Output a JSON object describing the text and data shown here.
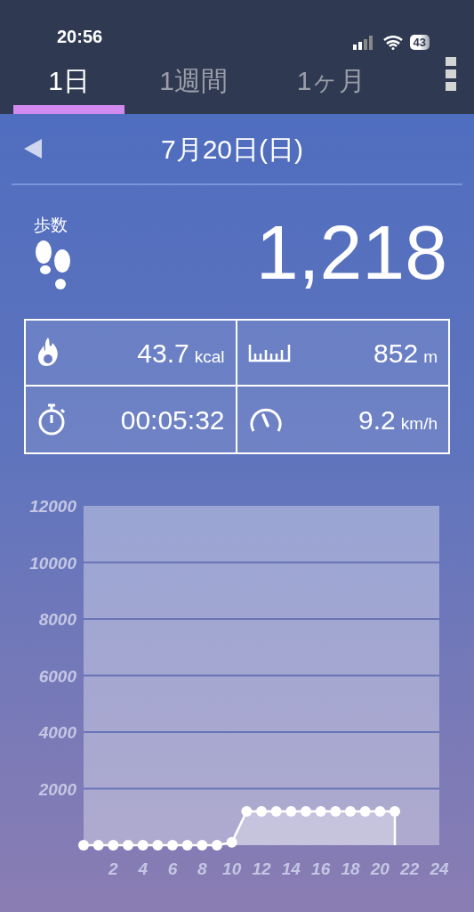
{
  "status_bar": {
    "time": "20:56",
    "battery": "43"
  },
  "tabs": [
    {
      "label": "1日",
      "selected": true
    },
    {
      "label": "1週間",
      "selected": false
    },
    {
      "label": "1ヶ月",
      "selected": false
    }
  ],
  "date": "7月20日(日)",
  "steps": {
    "label": "歩数",
    "value": "1,218"
  },
  "stats": [
    {
      "kind": "calories",
      "value": "43.7",
      "unit": "kcal"
    },
    {
      "kind": "distance",
      "value": "852",
      "unit": "m"
    },
    {
      "kind": "time",
      "value": "00:05:32"
    },
    {
      "kind": "speed",
      "value": "9.2",
      "unit": "km/h"
    }
  ],
  "chart_data": {
    "type": "area",
    "x": [
      0,
      1,
      2,
      3,
      4,
      5,
      6,
      7,
      8,
      9,
      10,
      11,
      12,
      13,
      14,
      15,
      16,
      17,
      18,
      19,
      20,
      21
    ],
    "grid": true,
    "series": [
      {
        "color": "#ffffff",
        "values": [
          0,
          0,
          0,
          0,
          0,
          0,
          0,
          0,
          0,
          0,
          100,
          1200,
          1200,
          1200,
          1200,
          1200,
          1200,
          1200,
          1200,
          1200,
          1200,
          1200
        ]
      }
    ],
    "xlim": [
      0,
      24
    ],
    "ylim": [
      0,
      12000
    ],
    "xticks": [
      2,
      4,
      6,
      8,
      10,
      12,
      14,
      16,
      18,
      20,
      22,
      24
    ],
    "yticks": [
      2000,
      4000,
      6000,
      8000,
      10000,
      12000
    ]
  }
}
